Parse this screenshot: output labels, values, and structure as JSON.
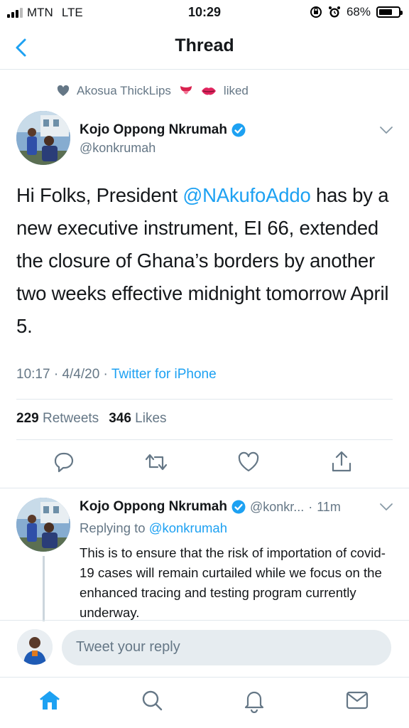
{
  "status_bar": {
    "carrier": "MTN",
    "network": "LTE",
    "time": "10:29",
    "battery": "68%",
    "battery_level": 0.68
  },
  "nav": {
    "title": "Thread"
  },
  "social_context": {
    "user": "Akosua ThickLips",
    "action": "liked"
  },
  "tweet": {
    "author_name": "Kojo Oppong Nkrumah",
    "author_handle": "@konkrumah",
    "text_parts": [
      {
        "text": "Hi Folks, President ",
        "mention": false
      },
      {
        "text": "@NAkufoAddo",
        "mention": true
      },
      {
        "text": " has by a new executive instrument, EI 66, extended the closure of Ghana’s borders by another two weeks effective midnight tomorrow April 5.",
        "mention": false
      }
    ],
    "time": "10:17",
    "date": "4/4/20",
    "source": "Twitter for iPhone",
    "separator": "·",
    "retweets_count": "229",
    "retweets_label": "Retweets",
    "likes_count": "346",
    "likes_label": "Likes"
  },
  "reply": {
    "author_name": "Kojo Oppong Nkrumah",
    "author_handle": "@konkr...",
    "separator": "·",
    "time": "11m",
    "replying_label": "Replying to",
    "replying_to": "@konkrumah",
    "text": "This is to ensure that the risk of importation of covid-19 cases will remain curtailed while we focus on the enhanced tracing and testing program currently underway."
  },
  "composer": {
    "placeholder": "Tweet your reply"
  },
  "colors": {
    "accent": "#1da1f2",
    "secondary_text": "#657786",
    "divider": "#e1e8ed"
  },
  "icons": {
    "back": "chevron-left-icon",
    "reply": "reply-icon",
    "retweet": "retweet-icon",
    "like": "heart-icon",
    "share": "share-icon",
    "home": "home-icon",
    "search": "search-icon",
    "notifications": "bell-icon",
    "messages": "mail-icon"
  }
}
